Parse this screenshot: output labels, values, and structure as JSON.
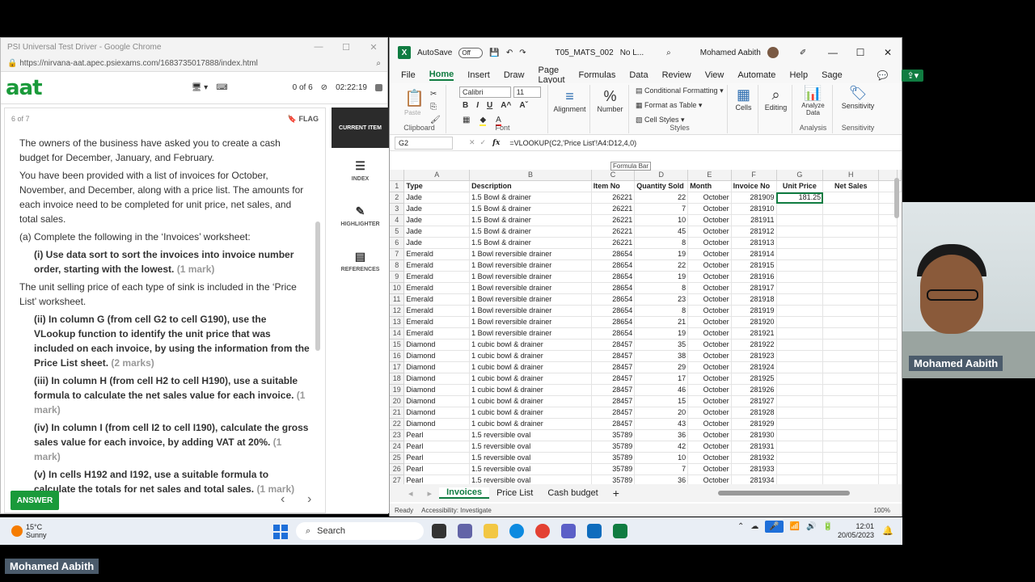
{
  "chrome": {
    "title": "PSI Universal Test Driver - Google Chrome",
    "url": "https://nirvana-aat.apec.psiexams.com/1683735017888/index.html"
  },
  "exam": {
    "logo": "aat",
    "progress": "0 of 6",
    "timer": "02:22:19",
    "item_counter": "6 of 7",
    "flag_label": "FLAG",
    "paragraphs": [
      "The owners of the business have asked you to create a cash budget for December, January, and February.",
      "You have been provided with a list of invoices for October, November, and December, along with a price list. The amounts for each invoice need to be completed for unit price, net sales, and total sales."
    ],
    "part_a": "(a) Complete the following in the ‘Invoices’ worksheet:",
    "i_text": "(i) Use data sort to sort the invoices into invoice number order, starting with the lowest.",
    "i_marks": "(1 mark)",
    "price_para": "The unit selling price of each type of sink is included in the ‘Price List’ worksheet.",
    "ii_text": "(ii) In column G (from cell G2 to cell G190), use the VLookup function to identify the unit price that was included on each invoice, by using the information from the Price List sheet.",
    "ii_marks": "(2 marks)",
    "iii_text": "(iii) In column H (from cell H2 to cell H190), use a suitable formula to calculate the net sales value for each invoice.",
    "iii_marks": "(1 mark)",
    "iv_text": "(iv) In column I (from cell I2 to cell I190), calculate the gross sales value for each invoice, by adding VAT at 20%.",
    "iv_marks": "(1 mark)",
    "v_text": "(v) In cells H192 and I192, use a suitable formula to calculate the totals for net sales and total sales.",
    "v_marks": "(1 mark)",
    "answer": "ANSWER",
    "nav": {
      "current": "CURRENT ITEM",
      "index": "INDEX",
      "highlighter": "HIGHLIGHTER",
      "references": "REFERENCES"
    }
  },
  "excel": {
    "autosave": "AutoSave",
    "toggle": "Off",
    "filename": "T05_MATS_002",
    "label": "No L...",
    "user": "Mohamed Aabith",
    "menus": [
      "File",
      "Home",
      "Insert",
      "Draw",
      "Page Layout",
      "Formulas",
      "Data",
      "Review",
      "View",
      "Automate",
      "Help",
      "Sage"
    ],
    "ribbon": {
      "paste": "Paste",
      "clipboard": "Clipboard",
      "font_name": "Calibri",
      "font_size": "11",
      "font": "Font",
      "alignment": "Alignment",
      "number": "Number",
      "cond": "Conditional Formatting",
      "fmt_table": "Format as Table",
      "cell_styles": "Cell Styles",
      "styles": "Styles",
      "cells": "Cells",
      "editing": "Editing",
      "analyze": "Analyze Data",
      "analysis": "Analysis",
      "sensitivity": "Sensitivity"
    },
    "namebox": "G2",
    "formula": "=VLOOKUP(C2,'Price List'!A4:D12,4,0)",
    "tooltip": "Formula Bar",
    "col_letters": [
      "A",
      "B",
      "C",
      "D",
      "E",
      "F",
      "G",
      "H"
    ],
    "headers": [
      "Type",
      "Description",
      "Item No",
      "Quantity Sold",
      "Month",
      "Invoice No",
      "Unit Price",
      "Net Sales"
    ],
    "rows": [
      [
        "Jade",
        "1.5 Bowl & drainer",
        "26221",
        "22",
        "October",
        "281909",
        "181.25"
      ],
      [
        "Jade",
        "1.5 Bowl & drainer",
        "26221",
        "7",
        "October",
        "281910",
        ""
      ],
      [
        "Jade",
        "1.5 Bowl & drainer",
        "26221",
        "10",
        "October",
        "281911",
        ""
      ],
      [
        "Jade",
        "1.5 Bowl & drainer",
        "26221",
        "45",
        "October",
        "281912",
        ""
      ],
      [
        "Jade",
        "1.5 Bowl & drainer",
        "26221",
        "8",
        "October",
        "281913",
        ""
      ],
      [
        "Emerald",
        "1 Bowl reversible drainer",
        "28654",
        "19",
        "October",
        "281914",
        ""
      ],
      [
        "Emerald",
        "1 Bowl reversible drainer",
        "28654",
        "22",
        "October",
        "281915",
        ""
      ],
      [
        "Emerald",
        "1 Bowl reversible drainer",
        "28654",
        "19",
        "October",
        "281916",
        ""
      ],
      [
        "Emerald",
        "1 Bowl reversible drainer",
        "28654",
        "8",
        "October",
        "281917",
        ""
      ],
      [
        "Emerald",
        "1 Bowl reversible drainer",
        "28654",
        "23",
        "October",
        "281918",
        ""
      ],
      [
        "Emerald",
        "1 Bowl reversible drainer",
        "28654",
        "8",
        "October",
        "281919",
        ""
      ],
      [
        "Emerald",
        "1 Bowl reversible drainer",
        "28654",
        "21",
        "October",
        "281920",
        ""
      ],
      [
        "Emerald",
        "1 Bowl reversible drainer",
        "28654",
        "19",
        "October",
        "281921",
        ""
      ],
      [
        "Diamond",
        "1 cubic bowl & drainer",
        "28457",
        "35",
        "October",
        "281922",
        ""
      ],
      [
        "Diamond",
        "1 cubic bowl & drainer",
        "28457",
        "38",
        "October",
        "281923",
        ""
      ],
      [
        "Diamond",
        "1 cubic bowl & drainer",
        "28457",
        "29",
        "October",
        "281924",
        ""
      ],
      [
        "Diamond",
        "1 cubic bowl & drainer",
        "28457",
        "17",
        "October",
        "281925",
        ""
      ],
      [
        "Diamond",
        "1 cubic bowl & drainer",
        "28457",
        "46",
        "October",
        "281926",
        ""
      ],
      [
        "Diamond",
        "1 cubic bowl & drainer",
        "28457",
        "15",
        "October",
        "281927",
        ""
      ],
      [
        "Diamond",
        "1 cubic bowl & drainer",
        "28457",
        "20",
        "October",
        "281928",
        ""
      ],
      [
        "Diamond",
        "1 cubic bowl & drainer",
        "28457",
        "43",
        "October",
        "281929",
        ""
      ],
      [
        "Pearl",
        "1.5 reversible oval",
        "35789",
        "36",
        "October",
        "281930",
        ""
      ],
      [
        "Pearl",
        "1.5 reversible oval",
        "35789",
        "42",
        "October",
        "281931",
        ""
      ],
      [
        "Pearl",
        "1.5 reversible oval",
        "35789",
        "10",
        "October",
        "281932",
        ""
      ],
      [
        "Pearl",
        "1.5 reversible oval",
        "35789",
        "7",
        "October",
        "281933",
        ""
      ],
      [
        "Pearl",
        "1.5 reversible oval",
        "35789",
        "36",
        "October",
        "281934",
        ""
      ]
    ],
    "sheets": [
      "Invoices",
      "Price List",
      "Cash budget"
    ],
    "status_ready": "Ready",
    "accessibility": "Accessibility: Investigate",
    "zoom": "100%"
  },
  "taskbar": {
    "temp": "15°C",
    "weather": "Sunny",
    "search": "Search",
    "time": "12:01",
    "date": "20/05/2023"
  },
  "webcam": {
    "name": "Mohamed Aabith"
  },
  "participant_label": "Mohamed Aabith"
}
